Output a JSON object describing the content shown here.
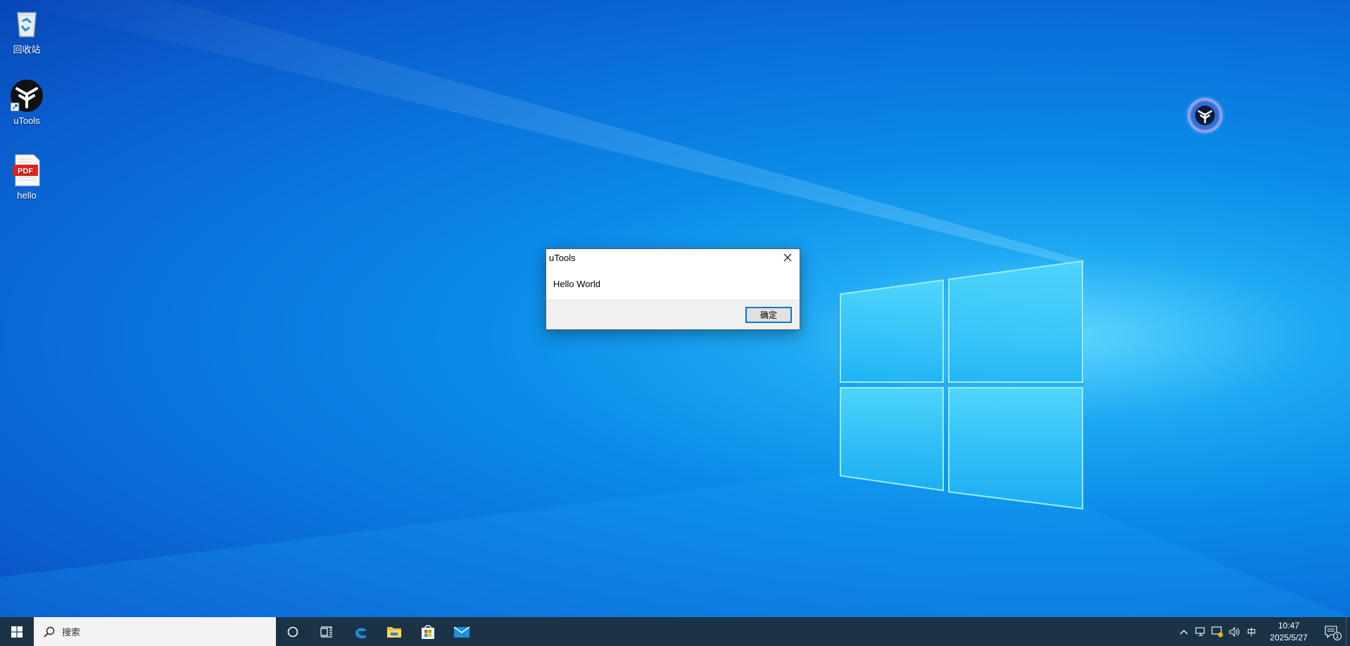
{
  "desktop": {
    "icons": [
      {
        "label": "回收站",
        "icon": "recycle-bin-icon"
      },
      {
        "label": "uTools",
        "icon": "utools-icon"
      },
      {
        "label": "hello",
        "icon": "pdf-icon",
        "badge": "PDF"
      }
    ],
    "floating_ball": {
      "icon": "utools-float-icon"
    }
  },
  "dialog": {
    "title": "uTools",
    "message": "Hello World",
    "ok_label": "确定"
  },
  "taskbar": {
    "search_placeholder": "搜索",
    "pinned": [
      "cortana-icon",
      "task-view-icon",
      "edge-icon",
      "file-explorer-icon",
      "store-icon",
      "mail-icon"
    ],
    "tray": {
      "ime": "中",
      "time": "10:47",
      "date": "2025/5/27",
      "notification_count": "1"
    }
  },
  "colors": {
    "taskbar": "#1b3346",
    "accent": "#0078d7"
  }
}
